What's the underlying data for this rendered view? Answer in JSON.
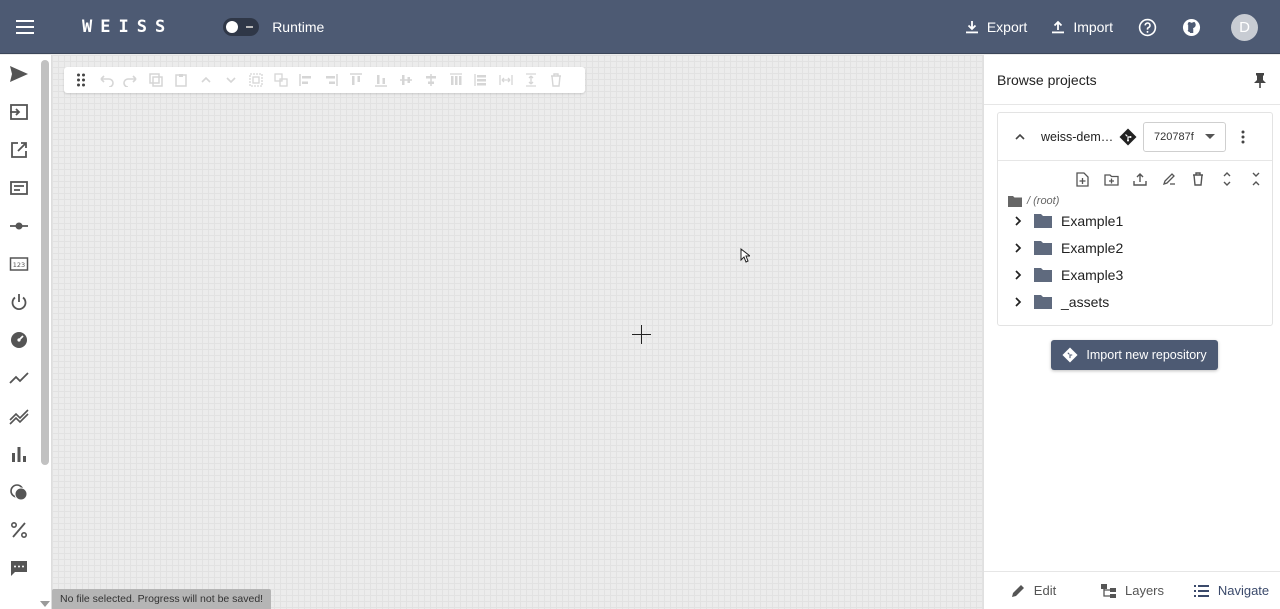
{
  "topbar": {
    "logo": "WEISS",
    "runtime_label": "Runtime",
    "export_label": "Export",
    "import_label": "Import",
    "avatar_initial": "D",
    "bg_color": "#4d5a73"
  },
  "leftbar": {
    "icons": [
      "send-icon",
      "input-icon",
      "open-in-new-icon",
      "label-icon",
      "slider-icon",
      "numeric-icon",
      "power-icon",
      "gauge-icon",
      "line-chart-icon",
      "multi-line-chart-icon",
      "bar-chart-icon",
      "dial-icon",
      "percent-icon",
      "comment-icon"
    ]
  },
  "canvas": {
    "toolbar_icons": [
      "drag-handle-icon",
      "undo-icon",
      "redo-icon",
      "copy-icon",
      "paste-icon",
      "move-up-icon",
      "move-down-icon",
      "group-icon",
      "ungroup-icon",
      "align-left-icon",
      "align-right-icon",
      "align-top-icon",
      "align-bottom-icon",
      "align-center-h-icon",
      "align-center-v-icon",
      "distribute-h-icon",
      "distribute-v-icon",
      "space-h-icon",
      "space-v-icon",
      "delete-icon"
    ],
    "status_message": "No file selected. Progress will not be saved!"
  },
  "rightpanel": {
    "title": "Browse projects",
    "repo": {
      "name": "weiss-dem…",
      "commit": "720787f"
    },
    "root_label": "/ (root)",
    "tree": [
      {
        "label": "Example1"
      },
      {
        "label": "Example2"
      },
      {
        "label": "Example3"
      },
      {
        "label": "_assets"
      }
    ],
    "import_button": "Import new repository",
    "tabs": {
      "edit": "Edit",
      "layers": "Layers",
      "navigate": "Navigate"
    }
  }
}
